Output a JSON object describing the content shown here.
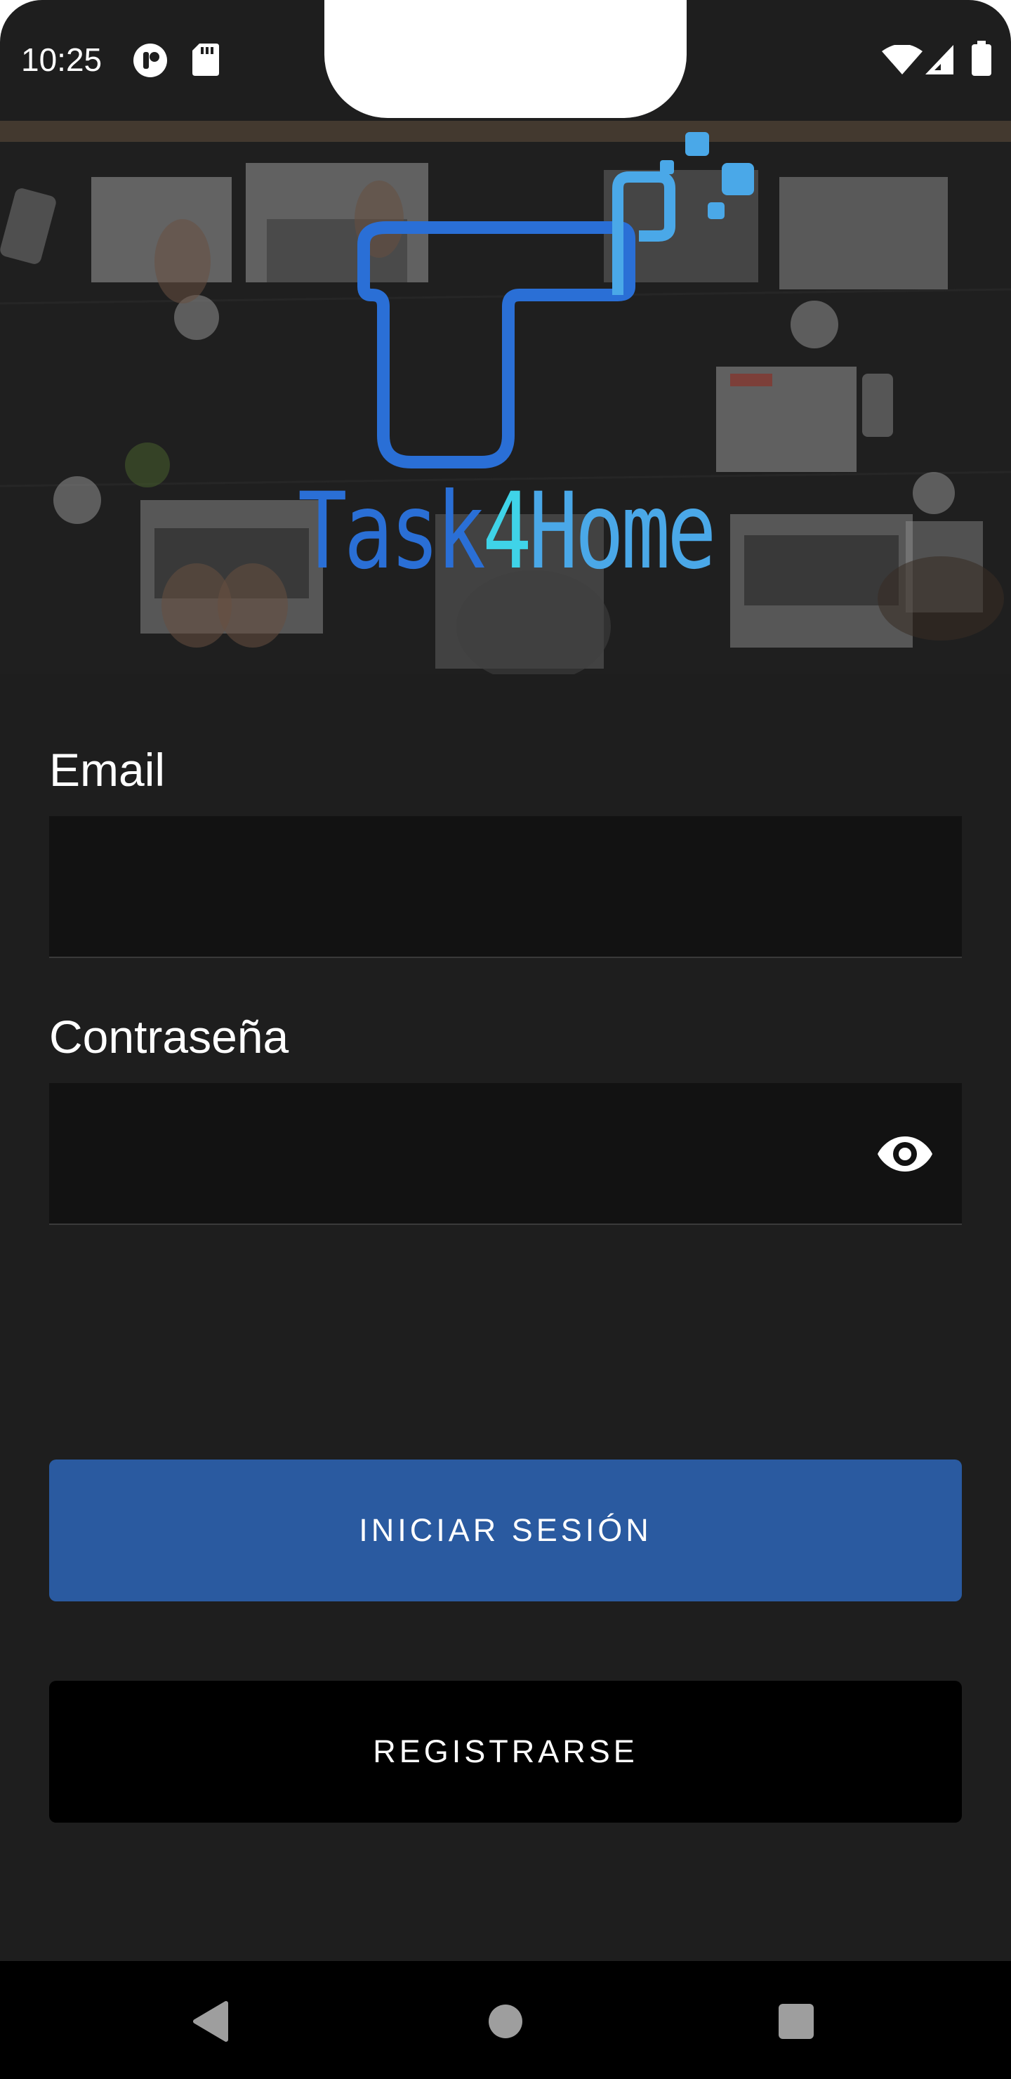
{
  "status_bar": {
    "time": "10:25",
    "left_icons": [
      "app-notification-icon",
      "sd-card-icon"
    ],
    "right_icons": [
      "wifi-icon",
      "cellular-signal-icon",
      "battery-icon"
    ]
  },
  "hero": {
    "logo_text_part1": "Task",
    "logo_text_digit": "4",
    "logo_text_part2": "Home",
    "colors": {
      "logo_blue": "#2a6fd6",
      "logo_cyan": "#3fd3e8",
      "logo_light_blue": "#4aa8e8"
    }
  },
  "form": {
    "email_label": "Email",
    "email_value": "",
    "password_label": "Contraseña",
    "password_value": "",
    "password_toggle_icon": "eye-icon"
  },
  "actions": {
    "login_label": "INICIAR SESIÓN",
    "register_label": "REGISTRARSE",
    "colors": {
      "login_bg": "#2a5aa0",
      "register_bg": "#000000"
    }
  },
  "nav_bar": {
    "icons": [
      "back-icon",
      "home-icon",
      "recents-icon"
    ]
  }
}
